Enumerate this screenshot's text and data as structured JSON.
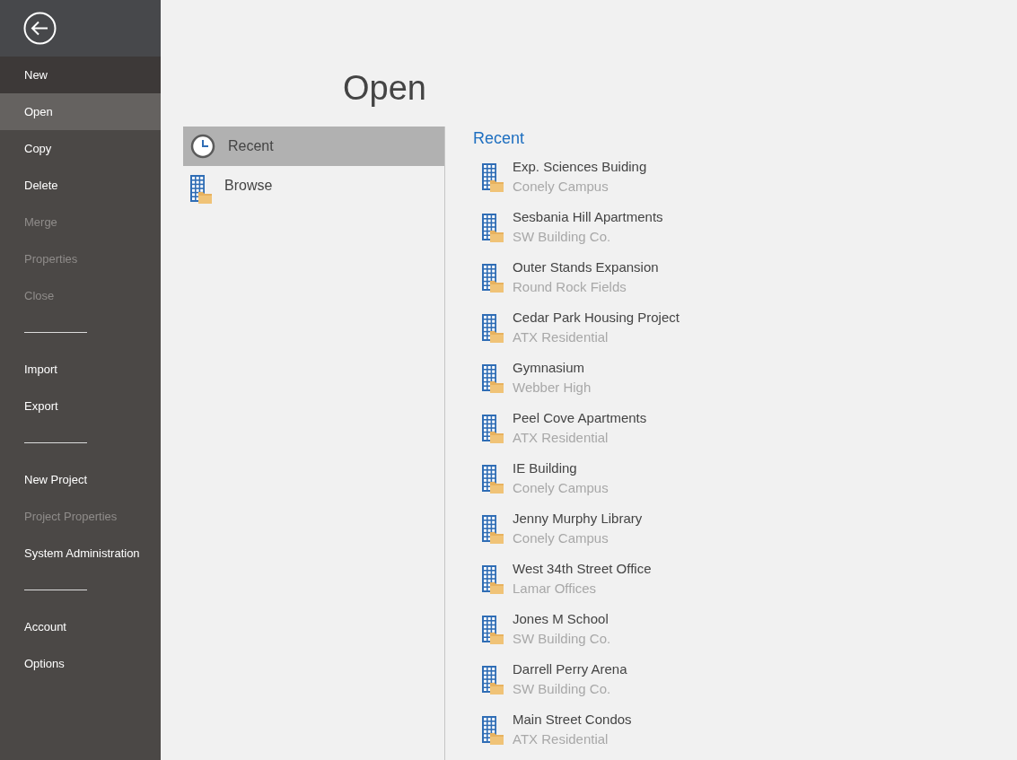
{
  "sidebar": {
    "items": [
      {
        "kind": "item",
        "label": "New",
        "selected": false,
        "hovered": true,
        "disabled": false
      },
      {
        "kind": "item",
        "label": "Open",
        "selected": true,
        "hovered": false,
        "disabled": false
      },
      {
        "kind": "item",
        "label": "Copy",
        "selected": false,
        "hovered": false,
        "disabled": false
      },
      {
        "kind": "item",
        "label": "Delete",
        "selected": false,
        "hovered": false,
        "disabled": false
      },
      {
        "kind": "item",
        "label": "Merge",
        "selected": false,
        "hovered": false,
        "disabled": true
      },
      {
        "kind": "item",
        "label": "Properties",
        "selected": false,
        "hovered": false,
        "disabled": true
      },
      {
        "kind": "item",
        "label": "Close",
        "selected": false,
        "hovered": false,
        "disabled": true
      },
      {
        "kind": "separator"
      },
      {
        "kind": "item",
        "label": "Import",
        "selected": false,
        "hovered": false,
        "disabled": false
      },
      {
        "kind": "item",
        "label": "Export",
        "selected": false,
        "hovered": false,
        "disabled": false
      },
      {
        "kind": "separator"
      },
      {
        "kind": "item",
        "label": "New Project",
        "selected": false,
        "hovered": false,
        "disabled": false
      },
      {
        "kind": "item",
        "label": "Project Properties",
        "selected": false,
        "hovered": false,
        "disabled": true
      },
      {
        "kind": "item",
        "label": "System Administration",
        "selected": false,
        "hovered": false,
        "disabled": false
      },
      {
        "kind": "separator"
      },
      {
        "kind": "item",
        "label": "Account",
        "selected": false,
        "hovered": false,
        "disabled": false
      },
      {
        "kind": "item",
        "label": "Options",
        "selected": false,
        "hovered": false,
        "disabled": false
      }
    ]
  },
  "page_title": "Open",
  "places": [
    {
      "kind": "recent",
      "label": "Recent",
      "selected": true
    },
    {
      "kind": "browse",
      "label": "Browse",
      "selected": false
    }
  ],
  "recent": {
    "heading": "Recent",
    "items": [
      {
        "name": "Exp. Sciences Buiding",
        "location": "Conely Campus"
      },
      {
        "name": "Sesbania Hill Apartments",
        "location": "SW Building Co."
      },
      {
        "name": "Outer Stands Expansion",
        "location": "Round Rock Fields"
      },
      {
        "name": "Cedar Park Housing Project",
        "location": "ATX Residential"
      },
      {
        "name": "Gymnasium",
        "location": "Webber High"
      },
      {
        "name": "Peel Cove Apartments",
        "location": "ATX Residential"
      },
      {
        "name": "IE Building",
        "location": "Conely Campus"
      },
      {
        "name": "Jenny Murphy Library",
        "location": "Conely Campus"
      },
      {
        "name": "West 34th Street Office",
        "location": "Lamar Offices"
      },
      {
        "name": "Jones M School",
        "location": "SW Building Co."
      },
      {
        "name": "Darrell Perry Arena",
        "location": "SW Building Co."
      },
      {
        "name": "Main Street Condos",
        "location": "ATX Residential"
      }
    ]
  }
}
